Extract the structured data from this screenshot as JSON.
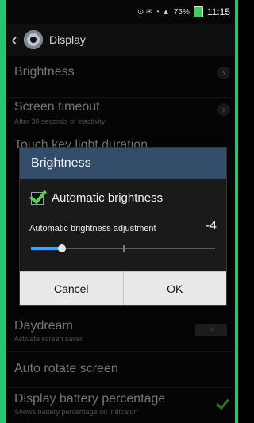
{
  "status_bar": {
    "signal_text": "75%",
    "time": "11:15"
  },
  "header": {
    "title": "Display",
    "back_icon": "chevron-left-icon",
    "settings_icon": "gear-icon"
  },
  "list": {
    "items": [
      {
        "label": "Brightness",
        "sub": "",
        "control": "chevron"
      },
      {
        "label": "Screen timeout",
        "sub": "After 30 seconds of inactivity",
        "control": "chevron"
      },
      {
        "label": "Touch key light duration",
        "sub": "",
        "control": ""
      },
      {
        "label": "Daydream",
        "sub": "Activate screen saver",
        "control": "toggle"
      },
      {
        "label": "Auto rotate screen",
        "sub": "",
        "control": ""
      },
      {
        "label": "Display battery percentage",
        "sub": "Shows battery percentage on indicator",
        "control": "check"
      }
    ]
  },
  "dialog": {
    "title": "Brightness",
    "auto_label": "Automatic brightness",
    "auto_checked": true,
    "adjustment_label": "Automatic brightness adjustment",
    "adjustment_value": "-4",
    "slider_fraction": 0.17,
    "cancel_label": "Cancel",
    "ok_label": "OK"
  },
  "colors": {
    "accent_green": "#25c66d",
    "dialog_header": "#334d6b",
    "slider_blue": "#39a6ff"
  }
}
